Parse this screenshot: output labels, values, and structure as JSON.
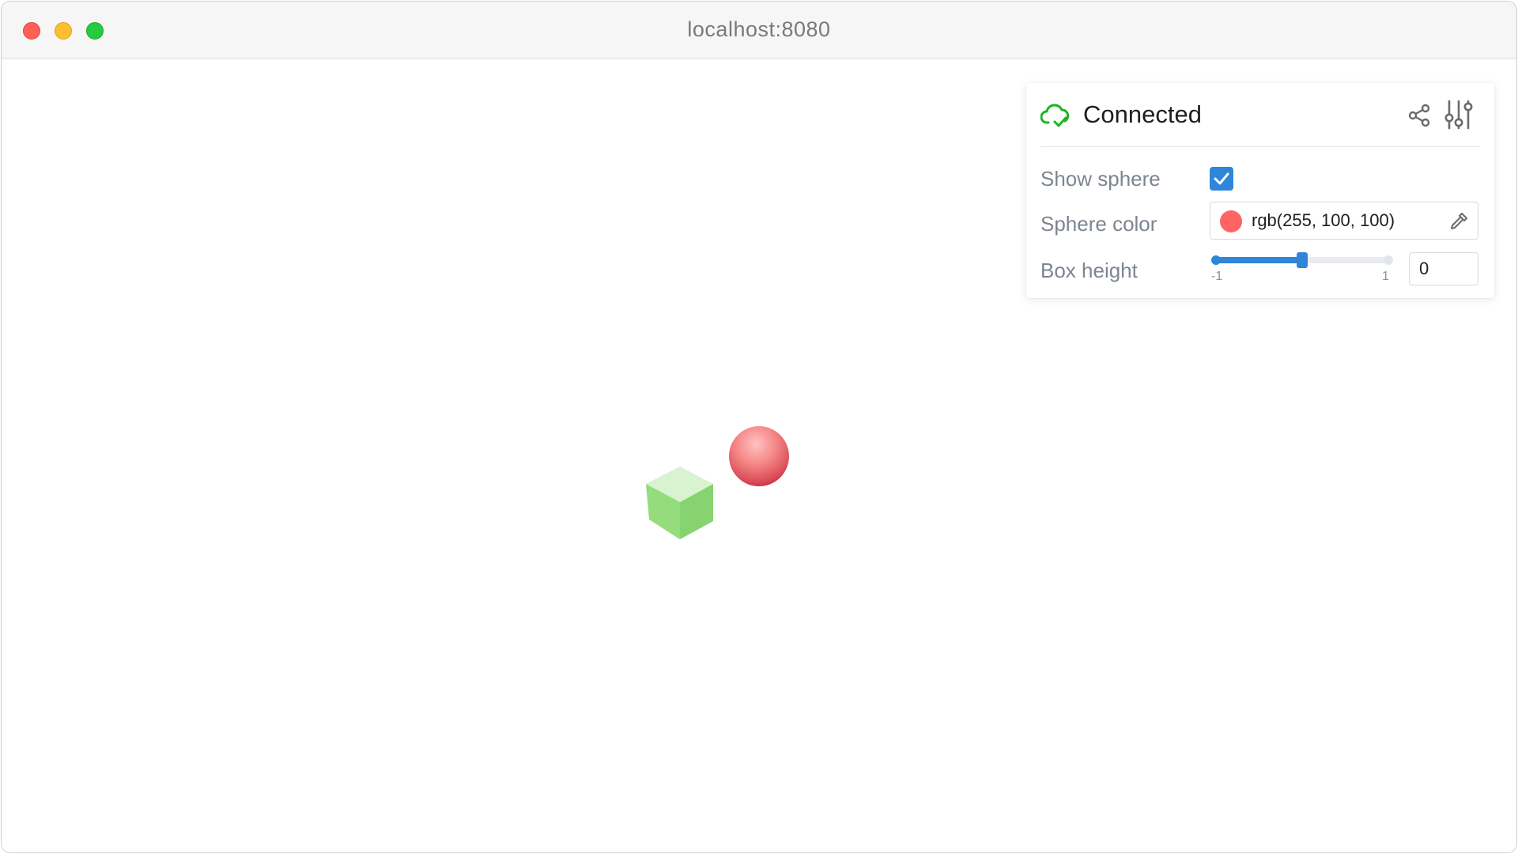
{
  "window": {
    "title": "localhost:8080"
  },
  "panel": {
    "status": {
      "text": "Connected",
      "icon": "cloud-check-icon",
      "color": "#1fb31f"
    },
    "header_actions": [
      {
        "name": "share-icon"
      },
      {
        "name": "sliders-settings-icon"
      }
    ],
    "controls": {
      "show_sphere": {
        "label": "Show sphere",
        "checked": true
      },
      "sphere_color": {
        "label": "Sphere color",
        "value": "rgb(255, 100, 100)",
        "swatch": "#ff6464",
        "icon": "eyedropper-icon"
      },
      "box_height": {
        "label": "Box height",
        "value": "0",
        "min": -1,
        "max": 1,
        "min_label": "-1",
        "max_label": "1"
      }
    },
    "accent": "#2f86d9"
  },
  "scene": {
    "objects": [
      {
        "type": "sphere",
        "color": "#ff6464"
      },
      {
        "type": "box",
        "color": "#8fd67a"
      }
    ]
  }
}
